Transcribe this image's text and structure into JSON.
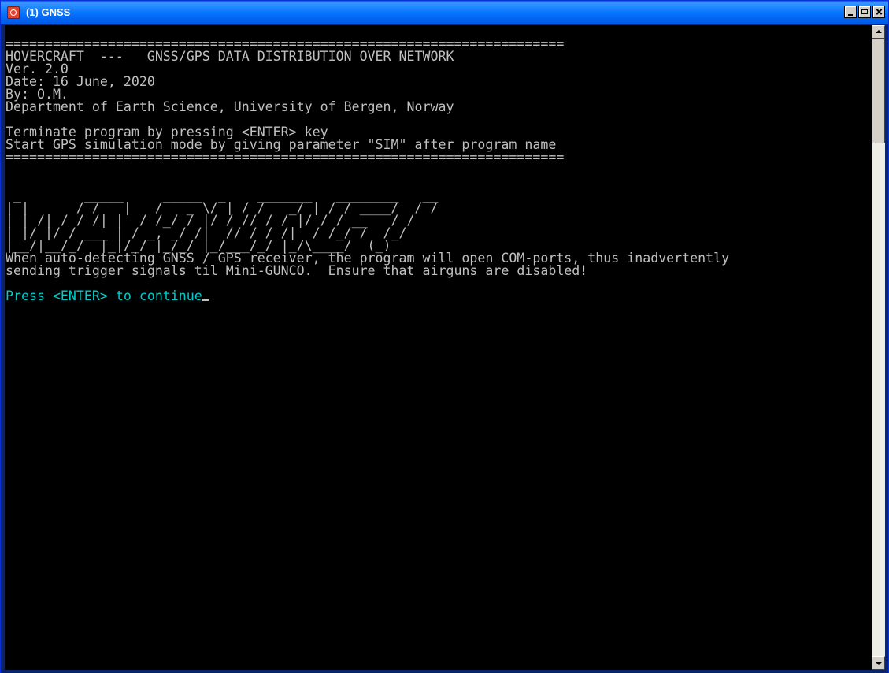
{
  "window": {
    "title": "(1) GNSS",
    "icon": "app-icon",
    "buttons": [
      "minimize-icon",
      "maximize-icon",
      "close-icon"
    ],
    "title_color": "#ffffff",
    "titlebar_color": "#0a6af3"
  },
  "console": {
    "background": "#000000",
    "text_color": "#c0c0c0",
    "prompt_color": "#00cccc",
    "lines": [
      "=======================================================================",
      "HOVERCRAFT  ---   GNSS/GPS DATA DISTRIBUTION OVER NETWORK",
      "Ver. 2.0",
      "Date: 16 June, 2020",
      "By: O.M.",
      "Department of Earth Science, University of Bergen, Norway",
      "",
      "Terminate program by pressing <ENTER> key",
      "Start GPS simulation mode by giving parameter \"SIM\" after program name",
      "=======================================================================",
      "",
      "",
      " _        _____     _____  _    _______   ________   __",
      "| |      / /   |   /   _ \\/ | / /   _/ | / / ____/  / /",
      "| | /| / / /| |  / /_/ / |/ / // / / |/ / / __   / /",
      "| |/ |/ / ___ | / _, _/ /|  // / / /|  / /_/ /  /_/",
      "|__/|__/_/  |_|/_/ |_/_/ |_/___/_/ |_/\\____/  (_)",
      "When auto-detecting GNSS / GPS receiver, the program will open COM-ports, thus inadvertently",
      "sending trigger signals til Mini-GUNCO.  Ensure that airguns are disabled!",
      ""
    ],
    "prompt": "Press <ENTER> to continue"
  },
  "scrollbar": {
    "up_icon": "scroll-up-arrow-icon",
    "down_icon": "scroll-down-arrow-icon"
  }
}
